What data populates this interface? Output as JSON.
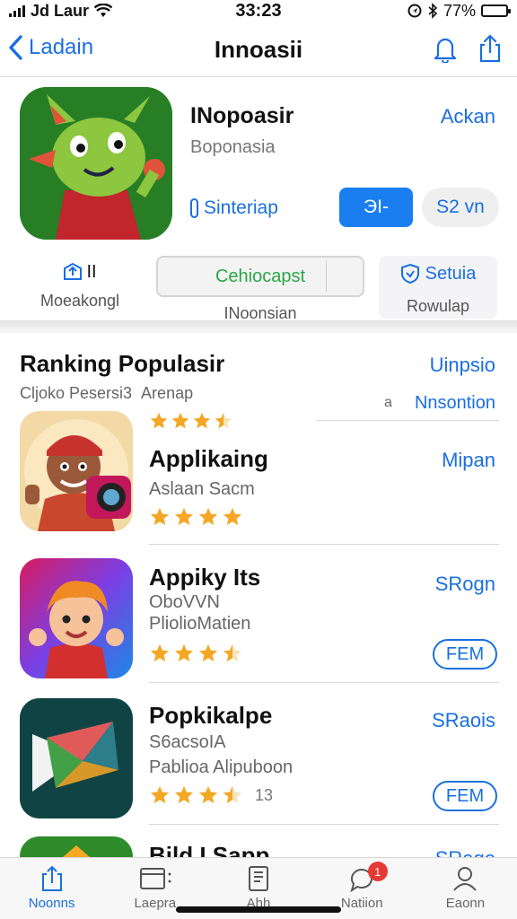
{
  "status_bar": {
    "carrier": "Jd Laur",
    "time": "33:23",
    "battery": "77%",
    "battery_level": 0.77
  },
  "nav": {
    "back_label": "Ladain",
    "title": "Innoasii"
  },
  "hero": {
    "app_name": "INopoasir",
    "subtitle": "Boponasia",
    "top_link": "Ackan",
    "developer": "Sinteriap",
    "button_primary": "ЭI-",
    "button_secondary": "S2 vn",
    "stat1_value": "II",
    "stat1_label": "Moeakongl",
    "pill_label": "Cehiocapst",
    "pill_sub": "INoonsian",
    "card3_title": "Setuia",
    "card3_sub": "Rowulap"
  },
  "ranking": {
    "heading": "Ranking Populasir",
    "link": "Uinpsio",
    "subheading": "Cljoko Pesersi3  Arenap",
    "number": "a",
    "more": "Nnsontion",
    "header_rating": 3.5
  },
  "apps": [
    {
      "title": "Applikaing",
      "line1": "Aslaan Sacm",
      "line2": "",
      "price": "Mipan",
      "rating": 4,
      "count": "",
      "button": ""
    },
    {
      "title": "Appiky Its",
      "line1": "OboVVN",
      "line2": "PliolioMatien",
      "price": "SRogn",
      "rating": 3.5,
      "count": "",
      "button": "FEM"
    },
    {
      "title": "Popkikalpe",
      "line1": "S6acsoIA",
      "line2": "Pablioa Alipuboon",
      "price": "SRaois",
      "rating": 3.5,
      "count": "13",
      "button": "FEM"
    },
    {
      "title": "Bild I Sapp",
      "line1": "",
      "line2": "",
      "price": "SRaqe",
      "rating": 0,
      "count": "",
      "button": ""
    }
  ],
  "tabs": [
    {
      "label": "Noonns",
      "icon": "today-icon"
    },
    {
      "label": "Laepra",
      "icon": "folder-icon"
    },
    {
      "label": "Ahh",
      "icon": "document-icon"
    },
    {
      "label": "Natiion",
      "icon": "notification-icon",
      "badge": "1"
    },
    {
      "label": "Eaonn",
      "icon": "profile-icon"
    }
  ],
  "colors": {
    "accent": "#1a6fe0",
    "star": "#f5a623",
    "badge": "#e53935",
    "green": "#28a745"
  }
}
